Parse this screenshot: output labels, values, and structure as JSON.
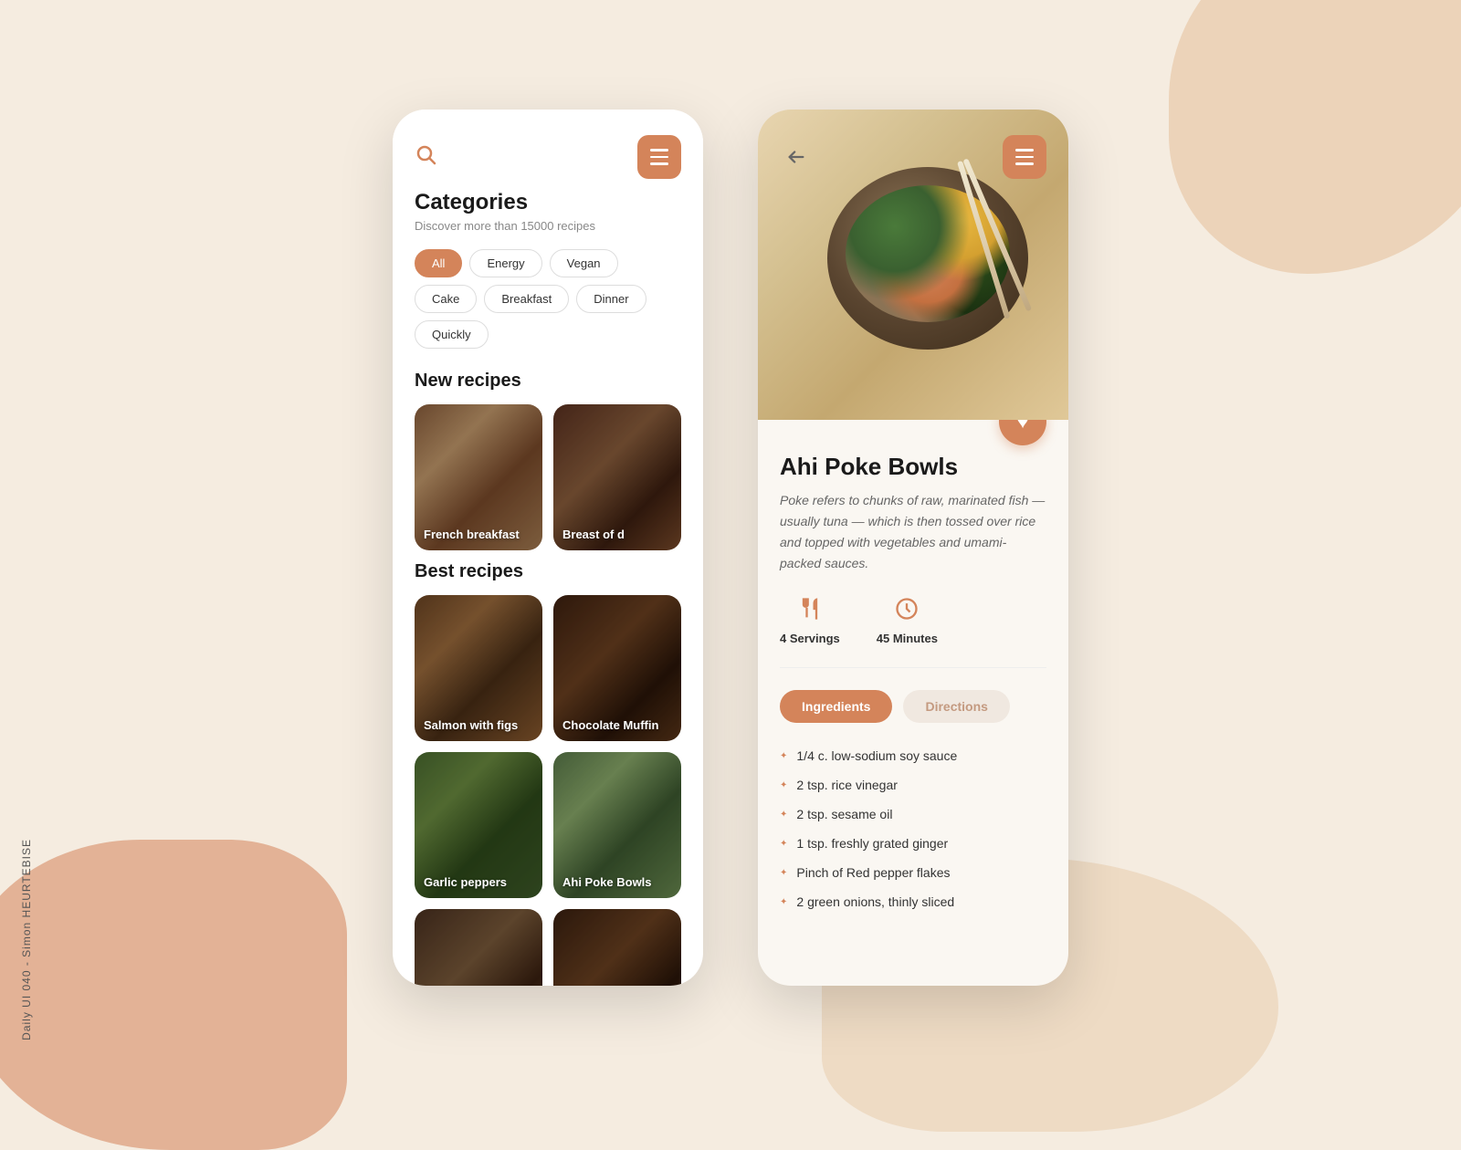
{
  "background": {
    "color": "#f5ece0"
  },
  "watermark": {
    "text": "Daily UI 040 - Simon HEURTEBISE"
  },
  "left_phone": {
    "header": {
      "menu_button_label": "menu"
    },
    "categories": {
      "title": "Categories",
      "subtitle": "Discover more than 15000 recipes"
    },
    "filters": [
      {
        "label": "All",
        "active": true
      },
      {
        "label": "Energy",
        "active": false
      },
      {
        "label": "Vegan",
        "active": false
      },
      {
        "label": "Cake",
        "active": false
      },
      {
        "label": "Breakfast",
        "active": false
      },
      {
        "label": "Dinner",
        "active": false
      },
      {
        "label": "Quickly",
        "active": false
      }
    ],
    "new_recipes_title": "New recipes",
    "new_recipes": [
      {
        "label": "French breakfast",
        "bg_class": "bg-french-breakfast"
      },
      {
        "label": "Breast of d",
        "bg_class": "bg-breast"
      }
    ],
    "best_recipes_title": "Best recipes",
    "best_recipes_row1": [
      {
        "label": "Salmon with figs",
        "bg_class": "bg-salmon-figs"
      },
      {
        "label": "Chocolate Muffin",
        "bg_class": "bg-chocolate-muffin"
      }
    ],
    "best_recipes_row2": [
      {
        "label": "Garlic peppers",
        "bg_class": "bg-garlic-peppers"
      },
      {
        "label": "Ahi Poke Bowls",
        "bg_class": "bg-poke-bowls"
      }
    ],
    "best_recipes_row3": [
      {
        "label": "",
        "bg_class": "bg-bottom1"
      },
      {
        "label": "",
        "bg_class": "bg-bottom2"
      }
    ]
  },
  "right_phone": {
    "recipe_title": "Ahi Poke Bowls",
    "description": "Poke refers to chunks of raw, marinated fish — usually tuna — which is then tossed over rice and topped with vegetables and umami-packed sauces.",
    "servings_label": "4 Servings",
    "time_label": "45 Minutes",
    "tabs": [
      {
        "label": "Ingredients",
        "active": true
      },
      {
        "label": "Directions",
        "active": false
      }
    ],
    "ingredients": [
      "1/4 c. low-sodium soy sauce",
      "2 tsp. rice vinegar",
      "2 tsp. sesame oil",
      "1 tsp. freshly grated ginger",
      "Pinch of Red pepper flakes",
      "2 green onions, thinly sliced"
    ]
  }
}
